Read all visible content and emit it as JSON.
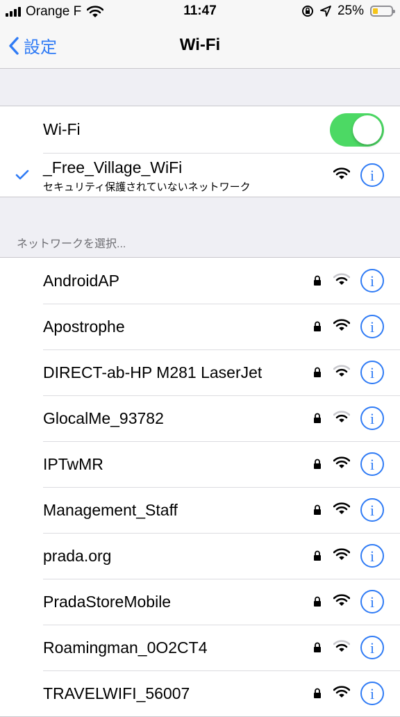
{
  "status_bar": {
    "carrier": "Orange F",
    "time": "11:47",
    "battery": "25%",
    "battery_level": 0.25
  },
  "nav": {
    "back_label": "設定",
    "title": "Wi-Fi"
  },
  "wifi_toggle": {
    "label": "Wi-Fi",
    "on": true,
    "color": "#4cd964"
  },
  "connected": {
    "ssid": "_Free_Village_WiFi",
    "subtitle": "セキュリティ保護されていないネットワーク",
    "signal": "full"
  },
  "section_header": "ネットワークを選択...",
  "networks": [
    {
      "ssid": "AndroidAP",
      "locked": true,
      "signal": "weak"
    },
    {
      "ssid": "Apostrophe",
      "locked": true,
      "signal": "full"
    },
    {
      "ssid": "DIRECT-ab-HP M281 LaserJet",
      "locked": true,
      "signal": "weak"
    },
    {
      "ssid": "GlocalMe_93782",
      "locked": true,
      "signal": "weak"
    },
    {
      "ssid": "IPTwMR",
      "locked": true,
      "signal": "full"
    },
    {
      "ssid": "Management_Staff",
      "locked": true,
      "signal": "full"
    },
    {
      "ssid": "prada.org",
      "locked": true,
      "signal": "full"
    },
    {
      "ssid": "PradaStoreMobile",
      "locked": true,
      "signal": "full"
    },
    {
      "ssid": "Roamingman_0O2CT4",
      "locked": true,
      "signal": "weak"
    },
    {
      "ssid": "TRAVELWIFI_56007",
      "locked": true,
      "signal": "full"
    }
  ],
  "icons": {
    "info": "i",
    "accent": "#2f7bf5"
  }
}
